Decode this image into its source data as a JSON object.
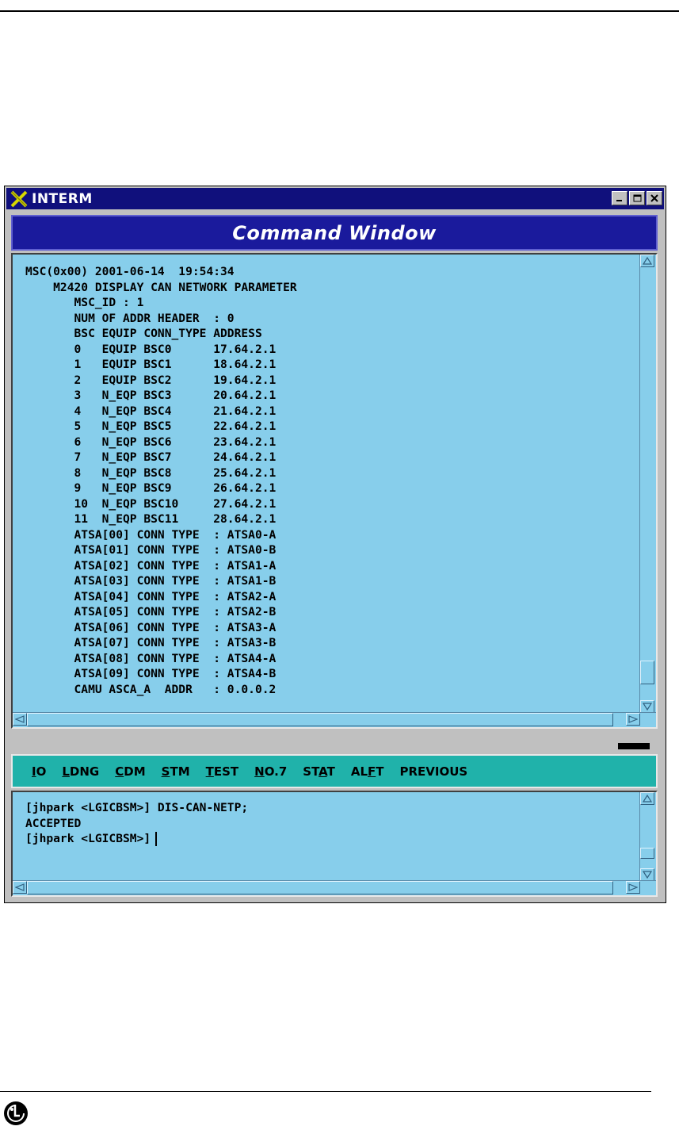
{
  "window": {
    "app_title": "INTERM",
    "header_title": "Command Window"
  },
  "output": {
    "lines": [
      "MSC(0x00) 2001-06-14  19:54:34",
      "    M2420 DISPLAY CAN NETWORK PARAMETER",
      "       MSC_ID : 1",
      "       NUM OF ADDR HEADER  : 0",
      "       BSC EQUIP CONN_TYPE ADDRESS",
      "       0   EQUIP BSC0      17.64.2.1",
      "       1   EQUIP BSC1      18.64.2.1",
      "       2   EQUIP BSC2      19.64.2.1",
      "       3   N_EQP BSC3      20.64.2.1",
      "       4   N_EQP BSC4      21.64.2.1",
      "       5   N_EQP BSC5      22.64.2.1",
      "       6   N_EQP BSC6      23.64.2.1",
      "       7   N_EQP BSC7      24.64.2.1",
      "       8   N_EQP BSC8      25.64.2.1",
      "       9   N_EQP BSC9      26.64.2.1",
      "       10  N_EQP BSC10     27.64.2.1",
      "       11  N_EQP BSC11     28.64.2.1",
      "       ATSA[00] CONN TYPE  : ATSA0-A",
      "       ATSA[01] CONN TYPE  : ATSA0-B",
      "       ATSA[02] CONN TYPE  : ATSA1-A",
      "       ATSA[03] CONN TYPE  : ATSA1-B",
      "       ATSA[04] CONN TYPE  : ATSA2-A",
      "       ATSA[05] CONN TYPE  : ATSA2-B",
      "       ATSA[06] CONN TYPE  : ATSA3-A",
      "       ATSA[07] CONN TYPE  : ATSA3-B",
      "       ATSA[08] CONN TYPE  : ATSA4-A",
      "       ATSA[09] CONN TYPE  : ATSA4-B",
      "       CAMU ASCA_A  ADDR   : 0.0.0.2"
    ]
  },
  "menu": {
    "items": [
      {
        "pre": "",
        "u": "I",
        "post": "O"
      },
      {
        "pre": "",
        "u": "L",
        "post": "DNG"
      },
      {
        "pre": "",
        "u": "C",
        "post": "DM"
      },
      {
        "pre": "",
        "u": "S",
        "post": "TM"
      },
      {
        "pre": "",
        "u": "T",
        "post": "EST"
      },
      {
        "pre": "",
        "u": "N",
        "post": "O.7"
      },
      {
        "pre": "ST",
        "u": "A",
        "post": "T"
      },
      {
        "pre": "AL",
        "u": "F",
        "post": "T"
      },
      {
        "pre": "PREVIOUS",
        "u": "",
        "post": ""
      }
    ]
  },
  "input": {
    "lines": [
      "[jhpark <LGICBSM>] DIS-CAN-NETP;",
      "ACCEPTED",
      "[jhpark <LGICBSM>]"
    ]
  }
}
